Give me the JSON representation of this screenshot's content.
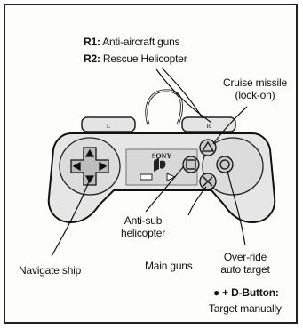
{
  "title_lines": [
    {
      "key": "R1:",
      "text": "Anti-aircraft guns"
    },
    {
      "key": "R2:",
      "text": "Rescue Helicopter"
    }
  ],
  "labels": {
    "cruise_missile": [
      "Cruise missile",
      "(lock-on)"
    ],
    "anti_sub": [
      "Anti-sub",
      "helicopter"
    ],
    "main_guns": "Main guns",
    "override": [
      "Over-ride",
      "auto target"
    ],
    "navigate": "Navigate ship",
    "target_key": "● + D-Button:",
    "target_text": "Target manually"
  },
  "controller": {
    "brand": "SONY",
    "l_button": "L",
    "r_button": "R"
  }
}
